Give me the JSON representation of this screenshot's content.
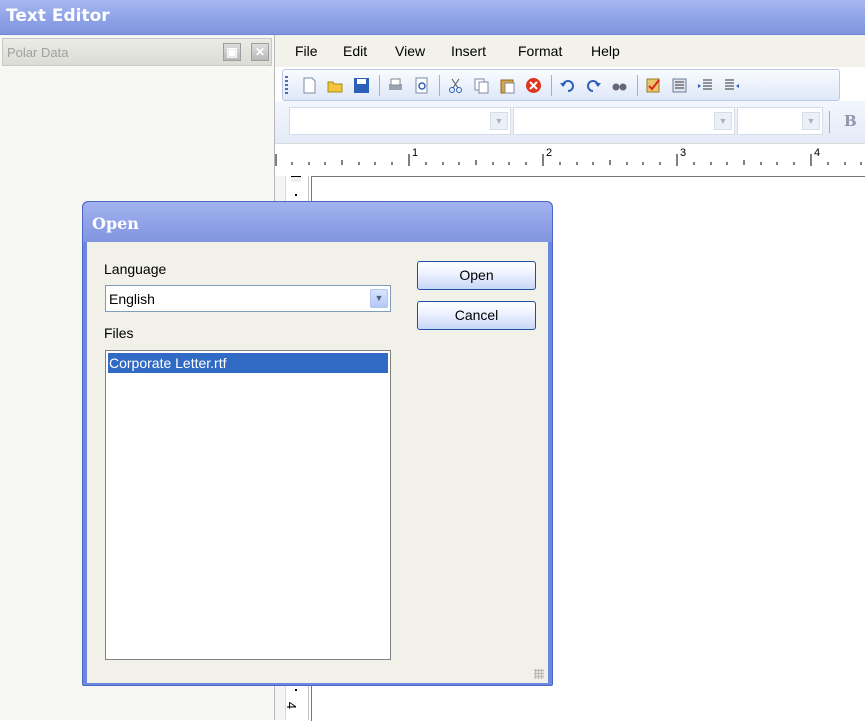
{
  "app": {
    "title": "Text Editor"
  },
  "panel": {
    "title": "Polar Data",
    "pin_glyph": "▣",
    "close_glyph": "✕"
  },
  "menu": [
    "File",
    "Edit",
    "View",
    "Insert",
    "Format",
    "Help"
  ],
  "toolbar": {
    "icons": [
      "new-document-icon",
      "open-folder-icon",
      "save-icon",
      "print-icon",
      "print-preview-icon",
      "cut-icon",
      "copy-icon",
      "paste-icon",
      "delete-icon",
      "undo-icon",
      "redo-icon",
      "find-icon",
      "spell-check-icon",
      "align-icon",
      "indent-icon",
      "outdent-icon"
    ]
  },
  "formatbar": {
    "bold_label": "B"
  },
  "ruler": {
    "marks": [
      "1",
      "2",
      "3",
      "4"
    ],
    "vertical_mark": "4"
  },
  "dialog": {
    "title": "Open",
    "language_label": "Language",
    "language_value": "English",
    "files_label": "Files",
    "files": [
      "Corporate Letter.rtf"
    ],
    "open_button": "Open",
    "cancel_button": "Cancel"
  },
  "colors": {
    "title_blue": "#8ea2e6",
    "selection": "#316ac5"
  }
}
